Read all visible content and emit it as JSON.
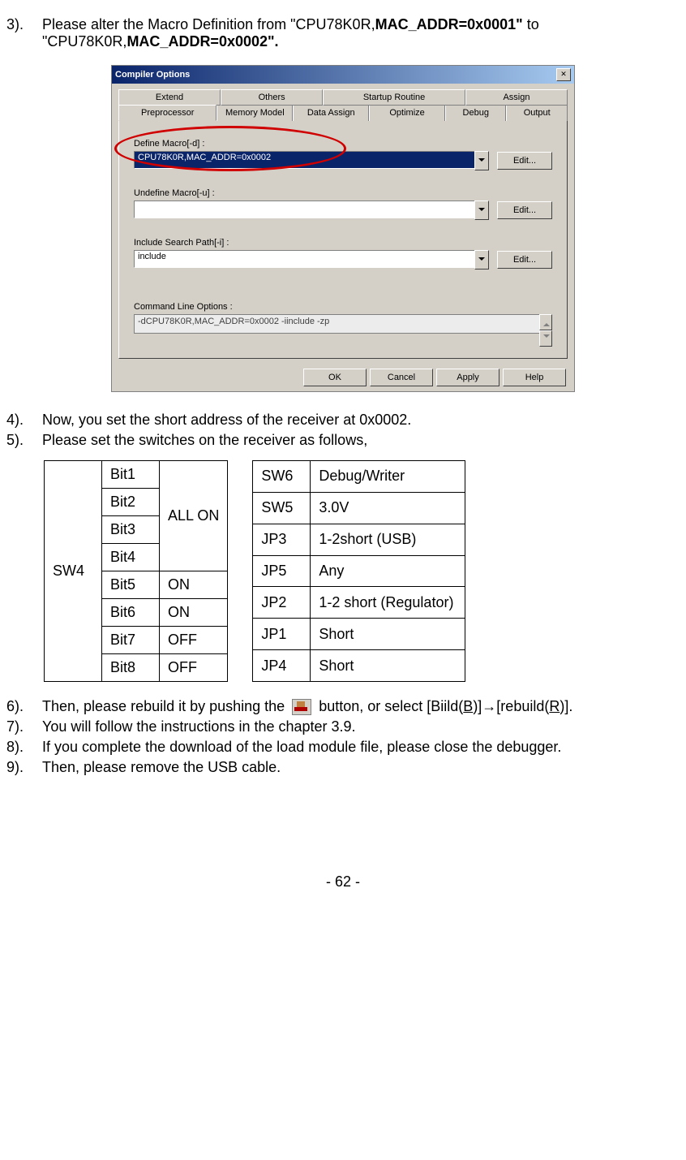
{
  "steps": {
    "s3_num": "3).",
    "s3_a": "Please alter the Macro Definition from \"CPU78K0R,",
    "s3_b": "MAC_ADDR=0x0001\"",
    "s3_c": " to \"CPU78K0R,",
    "s3_d": "MAC_ADDR=0x0002\".",
    "s4_num": "4).",
    "s4": "Now, you set the short address of the receiver at 0x0002.",
    "s5_num": "5).",
    "s5": "Please set the switches on the receiver as follows,",
    "s6_num": "6).",
    "s6_a": "Then, please rebuild it by pushing the ",
    "s6_b": " button, or select [Biild(",
    "s6_c": "B",
    "s6_d": ")]→[rebuild(",
    "s6_e": "R",
    "s6_f": ")].",
    "s7_num": "7).",
    "s7": "You will follow the instructions in the chapter 3.9.",
    "s8_num": "8).",
    "s8": "If you complete the download of the load module file, please close the debugger.",
    "s9_num": "9).",
    "s9": "Then, please remove the USB cable."
  },
  "dialog": {
    "title": "Compiler Options",
    "tabs_back": [
      "Extend",
      "Others",
      "Startup Routine",
      "Assign"
    ],
    "tabs_front": [
      "Preprocessor",
      "Memory Model",
      "Data Assign",
      "Optimize",
      "Debug",
      "Output"
    ],
    "define_label": "Define Macro[-d] :",
    "define_value": "CPU78K0R,MAC_ADDR=0x0002",
    "undefine_label": "Undefine Macro[-u] :",
    "undefine_value": "",
    "include_label": "Include Search Path[-i] :",
    "include_value": "include",
    "cmd_label": "Command Line Options :",
    "cmd_value": "-dCPU78K0R,MAC_ADDR=0x0002 -iinclude -zp",
    "edit": "Edit...",
    "ok": "OK",
    "cancel": "Cancel",
    "apply": "Apply",
    "help": "Help"
  },
  "sw4": {
    "head": "SW4",
    "rows": [
      {
        "bit": "Bit1",
        "val": ""
      },
      {
        "bit": "Bit2",
        "val": ""
      },
      {
        "bit": "Bit3",
        "val": ""
      },
      {
        "bit": "Bit4",
        "val": ""
      },
      {
        "bit": "Bit5",
        "val": "ON"
      },
      {
        "bit": "Bit6",
        "val": "ON"
      },
      {
        "bit": "Bit7",
        "val": "OFF"
      },
      {
        "bit": "Bit8",
        "val": "OFF"
      }
    ],
    "allon": "ALL ON"
  },
  "sw_other": [
    {
      "k": "SW6",
      "v": "Debug/Writer"
    },
    {
      "k": "SW5",
      "v": "3.0V"
    },
    {
      "k": "JP3",
      "v": "1-2short (USB)"
    },
    {
      "k": "JP5",
      "v": "Any"
    },
    {
      "k": "JP2",
      "v": "1-2 short (Regulator)"
    },
    {
      "k": "JP1",
      "v": "Short"
    },
    {
      "k": "JP4",
      "v": "Short"
    }
  ],
  "page": "- 62 -"
}
